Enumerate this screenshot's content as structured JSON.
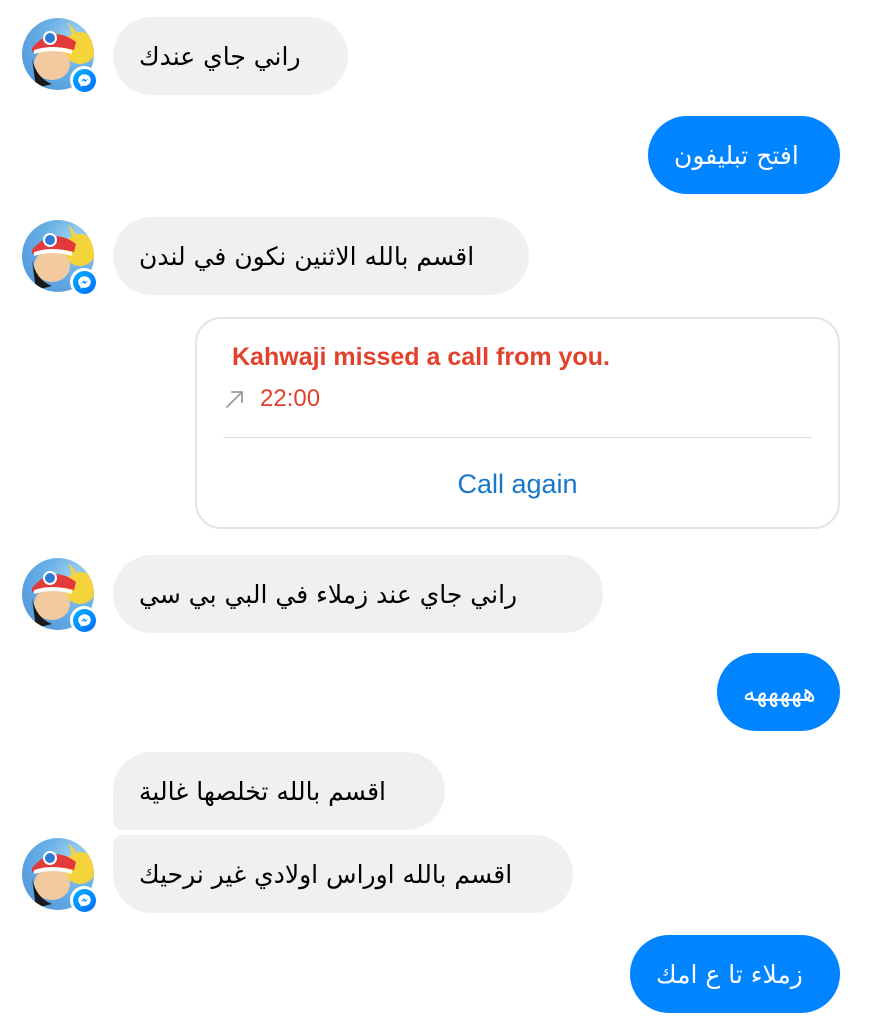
{
  "thread": {
    "messages": [
      {
        "text": "راني جاي عندك"
      },
      {
        "text": "افتح تبليفون"
      },
      {
        "text": "اقسم بالله الاثنين نكون في لندن"
      },
      {
        "text": "راني جاي عند زملاء في البي بي سي"
      },
      {
        "text": "هههههه"
      },
      {
        "text": "اقسم بالله تخلصها غالية"
      },
      {
        "text": "اقسم بالله اوراس اولادي غير نرحيك"
      },
      {
        "text": "زملاء تا ع امك"
      }
    ],
    "call_card": {
      "title": "Kahwaji missed a call from you.",
      "direction_icon": "outgoing-arrow-icon",
      "time": "22:00",
      "action_label": "Call again"
    }
  },
  "colors": {
    "incoming_bubble": "#f0f0f0",
    "outgoing_bubble": "#0084ff",
    "missed_call_red": "#e2412b",
    "link_blue": "#1877c9",
    "messenger_badge": "#006aff"
  },
  "avatar": {
    "icon": "contact-avatar",
    "badge_icon": "messenger-badge-icon"
  }
}
